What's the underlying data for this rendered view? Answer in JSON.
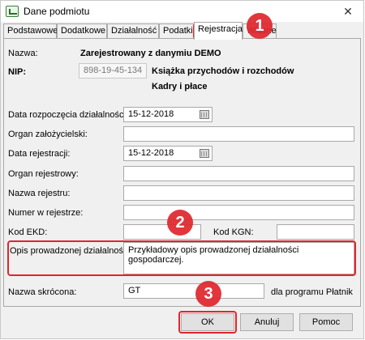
{
  "window": {
    "title": "Dane podmiotu",
    "close_glyph": "✕"
  },
  "tabs": [
    {
      "label": "Podstawowe",
      "active": false
    },
    {
      "label": "Dodatkowe",
      "active": false
    },
    {
      "label": "Działalność",
      "active": false
    },
    {
      "label": "Podatki",
      "active": false
    },
    {
      "label": "Rejestracja",
      "active": true
    },
    {
      "label": "Własne",
      "active": false
    }
  ],
  "header": {
    "nazwa_label": "Nazwa:",
    "nazwa_value": "Zarejestrowany z danymiu DEMO",
    "nip_label": "NIP:",
    "nip_value": "898-19-45-134",
    "book_type": "Książka przychodów i rozchodów",
    "payroll": "Kadry i płace"
  },
  "form": {
    "data_rozpoczecia_label": "Data rozpoczęcia działalności:",
    "data_rozpoczecia_value": "15-12-2018",
    "organ_zalozycielski_label": "Organ założycielski:",
    "organ_zalozycielski_value": "",
    "data_rejestracji_label": "Data rejestracji:",
    "data_rejestracji_value": "15-12-2018",
    "organ_rejestrowy_label": "Organ rejestrowy:",
    "organ_rejestrowy_value": "",
    "nazwa_rejestru_label": "Nazwa rejestru:",
    "nazwa_rejestru_value": "",
    "numer_rejestrze_label": "Numer w rejestrze:",
    "numer_rejestrze_value": "",
    "kod_ekd_label": "Kod EKD:",
    "kod_ekd_value": "",
    "kod_kgn_label": "Kod KGN:",
    "kod_kgn_value": "",
    "opis_label": "Opis prowadzonej działalności:",
    "opis_value": "Przykładowy opis prowadzonej działalności gospodarczej.",
    "nazwa_skrocona_label": "Nazwa skrócona:",
    "nazwa_skrocona_value": "GT",
    "platnik_note": "dla programu Płatnik"
  },
  "buttons": {
    "ok": "OK",
    "cancel": "Anuluj",
    "help": "Pomoc"
  },
  "annotations": {
    "marker_1": "1",
    "marker_2": "2",
    "marker_3": "3",
    "color": "#e0262d"
  }
}
